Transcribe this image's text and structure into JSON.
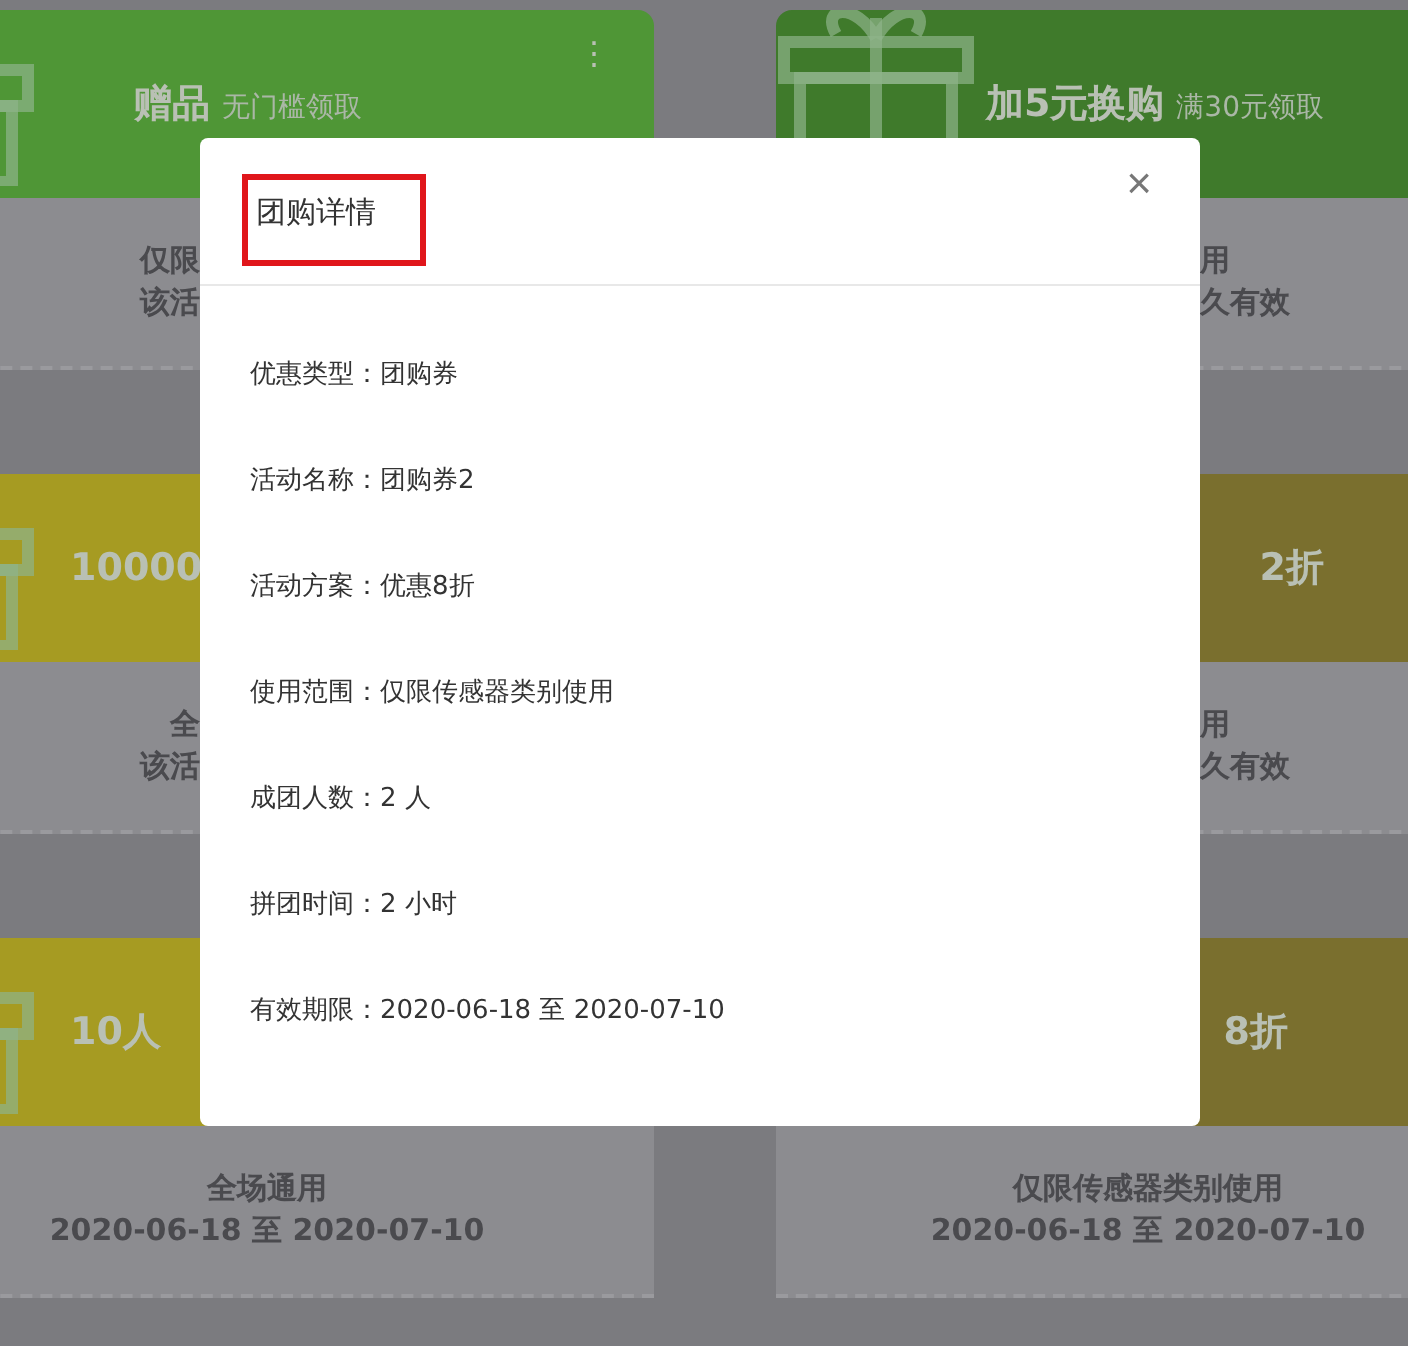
{
  "coupons": [
    {
      "title": "赠品",
      "subtitle": "无门槛领取",
      "menu": "⋮",
      "color": "#4f9636",
      "lines": [
        "仅限",
        "该活"
      ]
    },
    {
      "title": "加5元换购",
      "subtitle": "满30元领取",
      "color": "#3f7a2b",
      "lines": [
        "用",
        "久有效"
      ]
    },
    {
      "title": "10000",
      "color": "#a69b22",
      "lines": [
        "全",
        "该活"
      ]
    },
    {
      "title": "2折",
      "color": "#7a6f2e",
      "lines": [
        "用",
        "久有效"
      ]
    },
    {
      "title": "10人",
      "color": "#a69b22",
      "lines": [
        "全场通用",
        "2020-06-18 至 2020-07-10"
      ]
    },
    {
      "title": "8折",
      "color": "#7a6f2e",
      "lines": [
        "仅限传感器类别使用",
        "2020-06-18 至 2020-07-10"
      ]
    }
  ],
  "dialog": {
    "title": "团购详情",
    "close": "×",
    "fields": [
      {
        "label": "优惠类型：",
        "value": "团购券"
      },
      {
        "label": "活动名称：",
        "value": "团购券2"
      },
      {
        "label": "活动方案：",
        "value": "优惠8折"
      },
      {
        "label": "使用范围：",
        "value": "仅限传感器类别使用"
      },
      {
        "label": "成团人数：",
        "value": "2 人"
      },
      {
        "label": "拼团时间：",
        "value": "2 小时"
      },
      {
        "label": "有效期限：",
        "value": "2020-06-18 至 2020-07-10"
      }
    ]
  }
}
